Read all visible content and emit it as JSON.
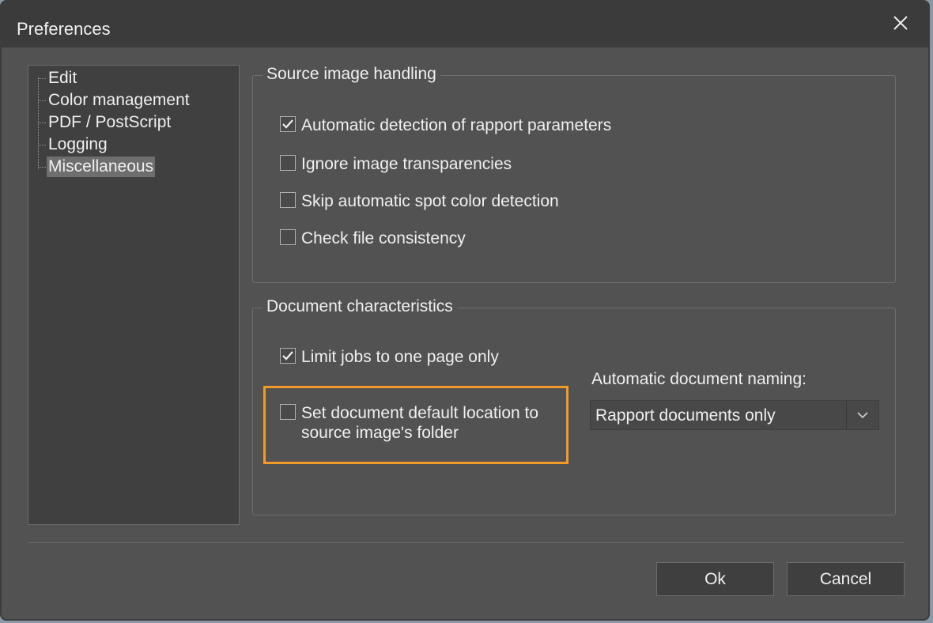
{
  "window": {
    "title": "Preferences",
    "close_icon": "close-icon"
  },
  "tree": {
    "items": [
      {
        "label": "Edit",
        "selected": false
      },
      {
        "label": "Color management",
        "selected": false
      },
      {
        "label": "PDF / PostScript",
        "selected": false
      },
      {
        "label": "Logging",
        "selected": false
      },
      {
        "label": "Miscellaneous",
        "selected": true
      }
    ]
  },
  "source_group": {
    "label": "Source image handling",
    "options": [
      {
        "label": "Automatic detection of rapport parameters",
        "checked": true
      },
      {
        "label": "Ignore image transparencies",
        "checked": false
      },
      {
        "label": "Skip automatic spot color detection",
        "checked": false
      },
      {
        "label": "Check file consistency",
        "checked": false
      }
    ]
  },
  "document_group": {
    "label": "Document characteristics",
    "limit_jobs": {
      "label": "Limit jobs to one page only",
      "checked": true
    },
    "default_location": {
      "line1": "Set document default location to",
      "line2": "source image's folder",
      "checked": false
    },
    "naming": {
      "label": "Automatic document naming:",
      "value": "Rapport documents only",
      "arrow_icon": "chevron-down-icon"
    }
  },
  "colors": {
    "highlight": "#f09a2a",
    "dialog_bg": "#525252",
    "titlebar_bg": "#3b3b3b"
  },
  "buttons": {
    "ok": "Ok",
    "cancel": "Cancel"
  }
}
